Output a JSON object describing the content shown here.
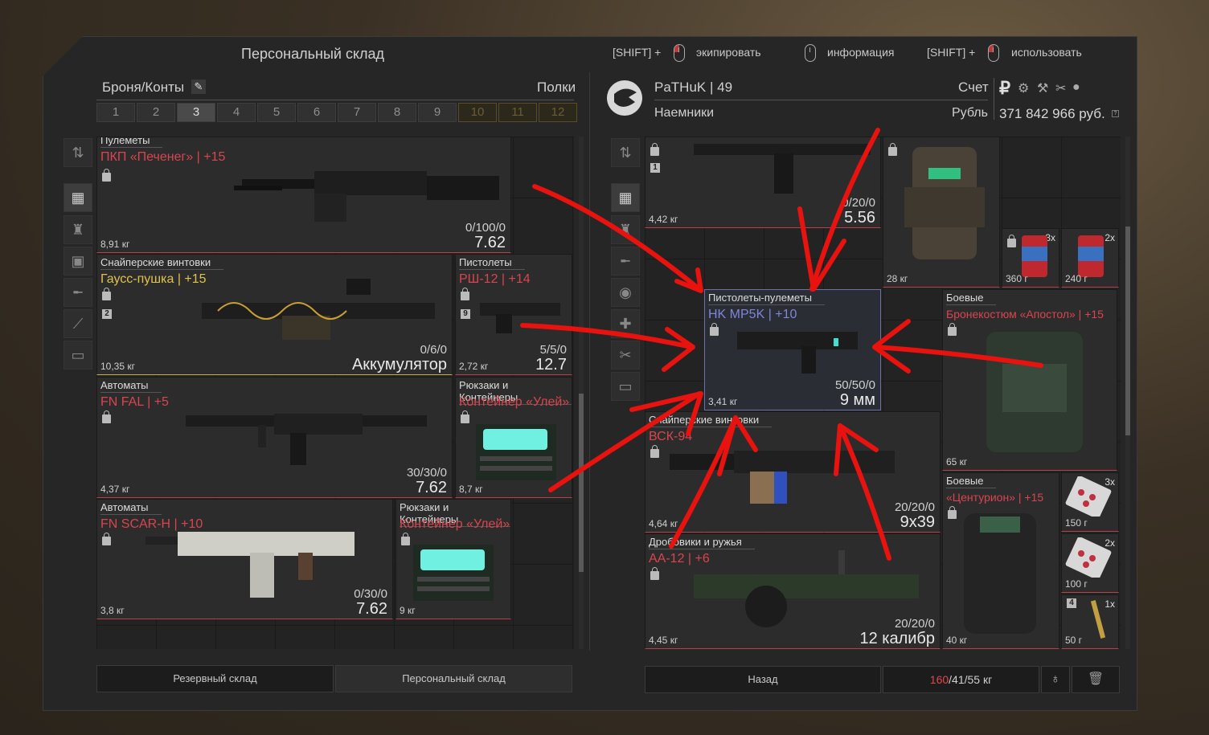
{
  "hints": {
    "equip_prefix": "[SHIFT] +",
    "equip_label": "экипировать",
    "info_label": "информация",
    "use_prefix": "[SHIFT] +",
    "use_label": "использовать"
  },
  "left": {
    "title": "Персональный склад",
    "category": "Броня/Конты",
    "shelves_label": "Полки",
    "tabs": [
      "1",
      "2",
      "3",
      "4",
      "5",
      "6",
      "7",
      "8",
      "9",
      "10",
      "11",
      "12"
    ],
    "active_tab": "3",
    "items": [
      {
        "cat": "Пулеметы",
        "name": "ПКП «Печенег» | +15",
        "weight": "8,91 кг",
        "ammo": "0/100/0",
        "cal": "7.62"
      },
      {
        "cat": "Снайперские винтовки",
        "name": "Гаусс-пушка | +15",
        "badge": "2",
        "weight": "10,35 кг",
        "ammo": "0/6/0",
        "cal": "Аккумулятор"
      },
      {
        "cat": "Пистолеты",
        "name": "РШ-12 | +14",
        "badge": "9",
        "weight": "2,72 кг",
        "ammo": "5/5/0",
        "cal": "12.7"
      },
      {
        "cat": "Автоматы",
        "name": "FN FAL | +5",
        "weight": "4,37 кг",
        "ammo": "30/30/0",
        "cal": "7.62"
      },
      {
        "cat": "Рюкзаки и Контейнеры",
        "name": "Контейнер «Улей»",
        "weight": "8,7 кг"
      },
      {
        "cat": "Автоматы",
        "name": "FN SCAR-H | +10",
        "weight": "3,8 кг",
        "ammo": "0/30/0",
        "cal": "7.62"
      },
      {
        "cat": "Рюкзаки и Контейнеры",
        "name": "Контейнер «Улей»",
        "weight": "9 кг"
      }
    ],
    "btn_reserve": "Резервный склад",
    "btn_personal": "Персональный склад"
  },
  "right": {
    "player": "PaTHuK | 49",
    "faction": "Наемники",
    "account_label": "Счет",
    "currency_label": "Рубль",
    "balance": "371 842 966 руб.",
    "items": [
      {
        "badge": "1",
        "weight": "4,42 кг",
        "ammo": "0/20/0",
        "cal": "5.56"
      },
      {
        "weight": "28 кг"
      },
      {
        "count": "3x",
        "weight": "360 г"
      },
      {
        "count": "2x",
        "weight": "240 г"
      },
      {
        "cat": "Пистолеты-пулеметы",
        "name": "HK MP5K | +10",
        "weight": "3,41 кг",
        "ammo": "50/50/0",
        "cal": "9 мм"
      },
      {
        "cat": "Боевые",
        "name": "Бронекостюм «Апостол» | +15",
        "weight": "65 кг"
      },
      {
        "cat": "Снайперские винтовки",
        "name": "ВСК-94",
        "weight": "4,64 кг",
        "ammo": "20/20/0",
        "cal": "9x39"
      },
      {
        "cat": "Боевые",
        "name": "«Центурион» | +15",
        "weight": "40 кг"
      },
      {
        "count": "3x",
        "weight": "150 г"
      },
      {
        "count": "2x",
        "weight": "100 г"
      },
      {
        "badge": "4",
        "count": "1x",
        "weight": "50 г"
      },
      {
        "cat": "Дробовики и ружья",
        "name": "АА-12 | +6",
        "weight": "4,45 кг",
        "ammo": "20/20/0",
        "cal": "12 калибр"
      }
    ],
    "btn_back": "Назад",
    "weight_current": "160",
    "weight_rest": "/41/55 кг"
  },
  "colors": {
    "accent_red": "#d8454f",
    "gold": "#e0c24a",
    "blue": "#7f86d8",
    "arrow": "#e8120e"
  }
}
